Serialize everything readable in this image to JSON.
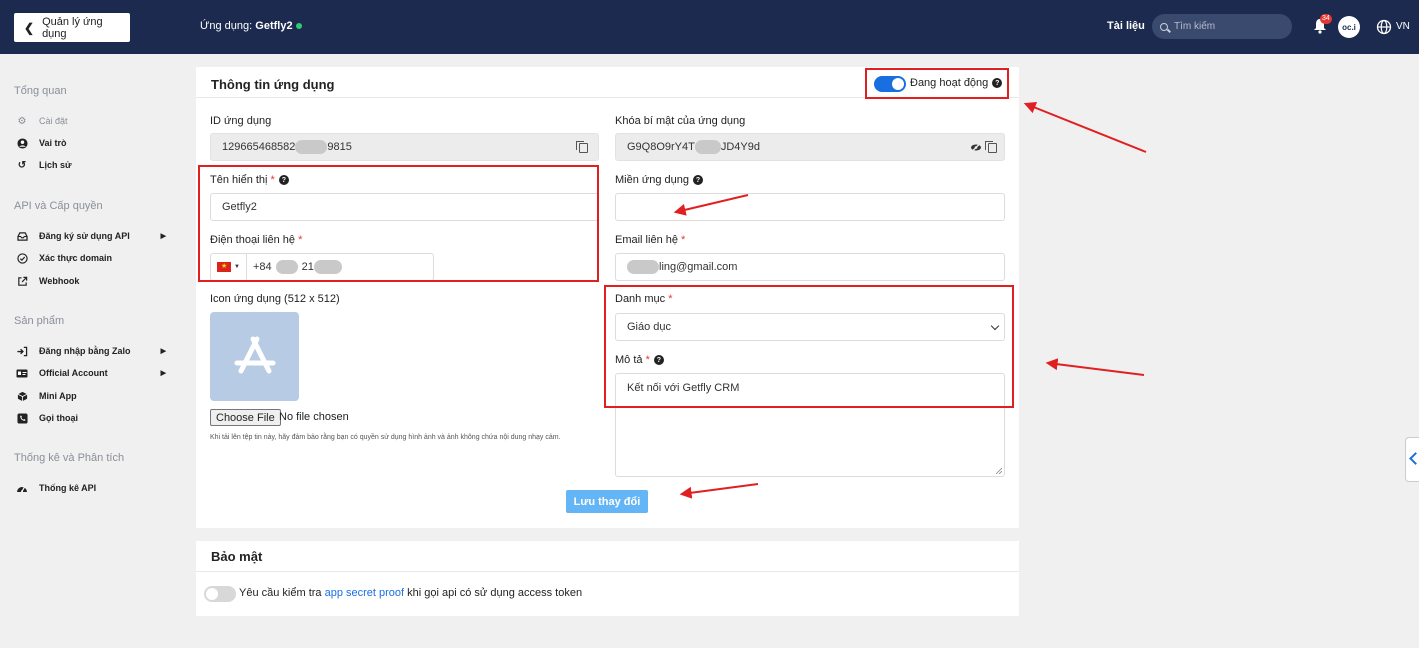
{
  "topbar": {
    "back_label": "Quản lý ứng dụng",
    "app_prefix": "Ứng dụng:",
    "app_name": "Getfly2",
    "docs": "Tài liệu",
    "search_placeholder": "Tìm kiếm",
    "notification_count": "34",
    "avatar_text": "oc.i",
    "language": "VN"
  },
  "sidebar": {
    "overview": "Tổng quan",
    "overview_items": [
      {
        "label": "Cài đặt",
        "icon": "gear-icon"
      },
      {
        "label": "Vai trò",
        "icon": "user-circle-icon"
      },
      {
        "label": "Lịch sử",
        "icon": "history-icon"
      }
    ],
    "api_section": "API và Cấp quyền",
    "api_items": [
      {
        "label": "Đăng ký sử dụng API",
        "icon": "inbox-icon"
      },
      {
        "label": "Xác thực domain",
        "icon": "check-circle-icon"
      },
      {
        "label": "Webhook",
        "icon": "external-link-icon"
      }
    ],
    "products_section": "Sản phẩm",
    "product_items": [
      {
        "label": "Đăng nhập bằng Zalo",
        "icon": "login-icon"
      },
      {
        "label": "Official Account",
        "icon": "id-card-icon"
      },
      {
        "label": "Mini App",
        "icon": "cube-icon"
      },
      {
        "label": "Gọi thoại",
        "icon": "phone-icon"
      }
    ],
    "stats_section": "Thống kê và Phân tích",
    "stats_items": [
      {
        "label": "Thống kê API",
        "icon": "gauge-icon"
      }
    ]
  },
  "info_card": {
    "title": "Thông tin ứng dụng",
    "status_label": "Đang hoạt động",
    "app_id_label": "ID ứng dụng",
    "app_id_prefix": "129665468582",
    "app_id_suffix": "9815",
    "secret_label": "Khóa bí mật của ứng dụng",
    "secret_prefix": "G9Q8O9rY4T",
    "secret_suffix": "JD4Y9d",
    "display_name_label": "Tên hiển thị",
    "display_name_value": "Getfly2",
    "domain_label": "Miền ứng dụng",
    "domain_value": "",
    "phone_label": "Điện thoại liên hệ",
    "phone_prefix": "+84",
    "phone_part": "21",
    "email_label": "Email liên hệ",
    "email_suffix": "ling@gmail.com",
    "icon_label": "Icon ứng dụng (512 x 512)",
    "choose_file": "Choose File",
    "no_file": "No file chosen",
    "upload_hint": "Khi tải lên tệp tin này, hãy đảm bảo rằng bạn có quyền sử dụng hình ảnh và ảnh không chứa nội dung nhạy cảm.",
    "category_label": "Danh mục",
    "category_value": "Giáo dục",
    "description_label": "Mô tả",
    "description_value": "Kết nối với Getfly CRM",
    "save_label": "Lưu thay đổi"
  },
  "security_card": {
    "title": "Bảo mật",
    "text_before": "Yêu cầu kiểm tra",
    "link_text": "app secret proof",
    "text_after": "khi gọi api có sử dụng access token"
  },
  "colors": {
    "topbar": "#1b2a4e",
    "accent": "#1a6fe0",
    "annotation": "#e02020",
    "save_button": "#64b5f6"
  }
}
